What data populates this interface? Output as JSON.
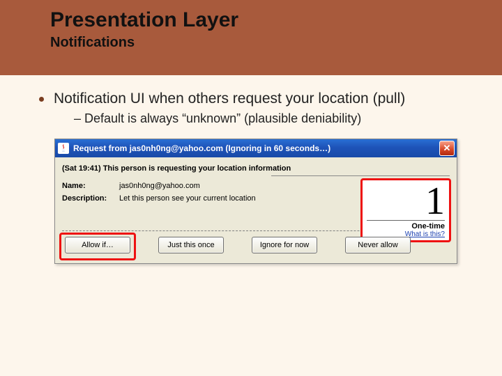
{
  "header": {
    "title": "Presentation Layer",
    "subtitle": "Notifications"
  },
  "bullet": {
    "main": "Notification UI when others request your location (pull)",
    "sub": "– Default is always “unknown” (plausible deniability)"
  },
  "dialog": {
    "title": "Request from jas0nh0ng@yahoo.com (Ignoring in 60 seconds…)",
    "close_glyph": "✕",
    "top_line": "(Sat 19:41) This person is requesting your location information",
    "name_label": "Name:",
    "name_value": "jas0nh0ng@yahoo.com",
    "desc_label": "Description:",
    "desc_value": "Let this person see your current location",
    "one_time": {
      "number": "1",
      "label": "One-time",
      "link": "What is this?"
    },
    "buttons": {
      "allow_if": "Allow if…",
      "just_once": "Just this once",
      "ignore": "Ignore for now",
      "never": "Never allow"
    }
  }
}
